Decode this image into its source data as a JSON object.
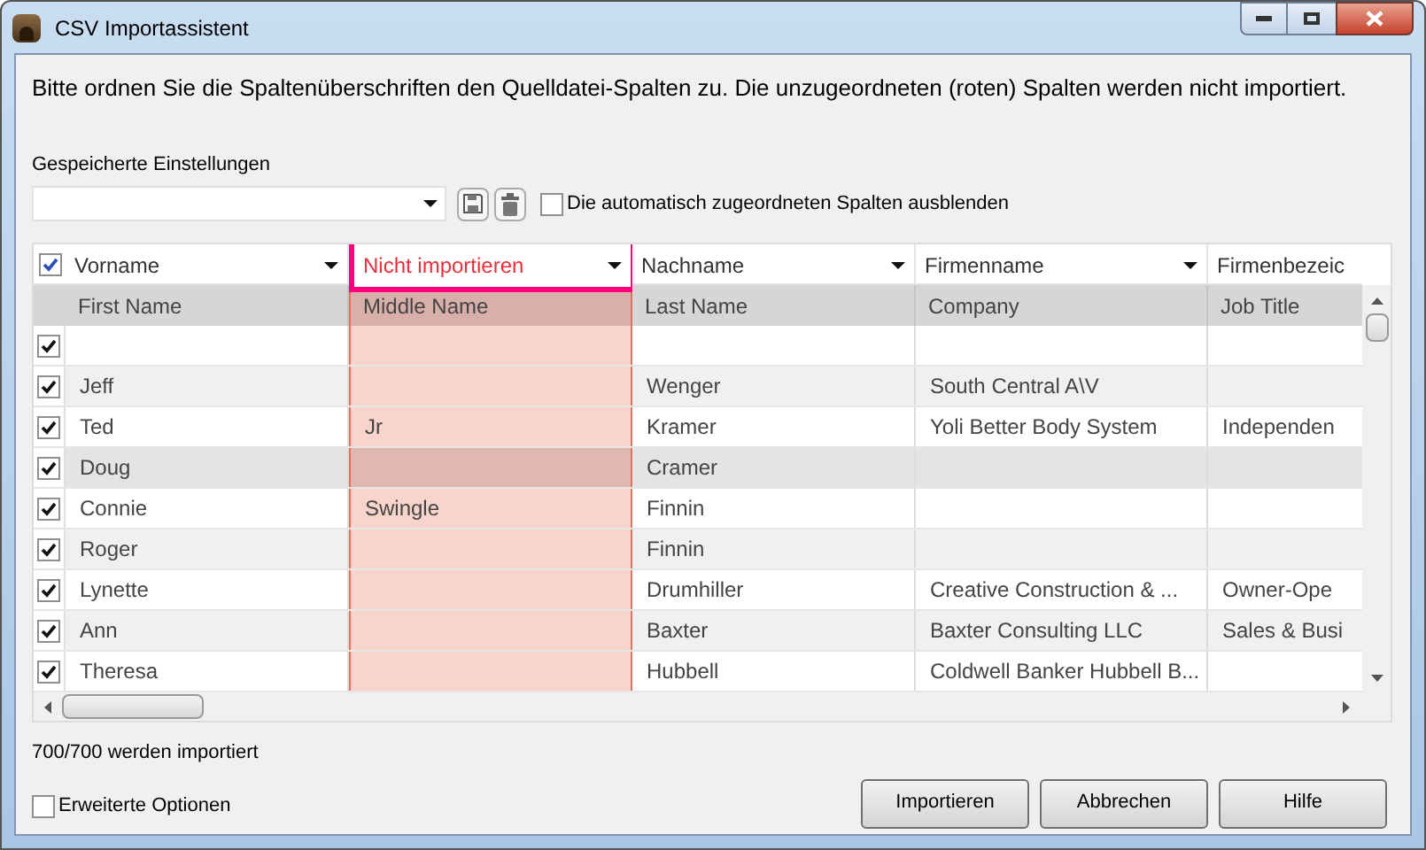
{
  "window": {
    "title": "CSV Importassistent"
  },
  "instructions": "Bitte ordnen Sie die Spaltenüberschriften den Quelldatei-Spalten zu. Die unzugeordneten (roten) Spalten werden nicht importiert.",
  "saved_settings": {
    "label": "Gespeicherte Einstellungen"
  },
  "hide_assigned": {
    "label": "Die automatisch zugeordneten Spalten ausblenden",
    "checked": false
  },
  "table": {
    "select_all_checked": true,
    "columns": [
      {
        "mapping": "Vorname",
        "source": "First Name",
        "ignored": false,
        "highlighted": false,
        "dropdown": true
      },
      {
        "mapping": "Nicht importieren",
        "source": "Middle Name",
        "ignored": true,
        "highlighted": true,
        "dropdown": true
      },
      {
        "mapping": "Nachname",
        "source": "Last Name",
        "ignored": false,
        "highlighted": false,
        "dropdown": true
      },
      {
        "mapping": "Firmenname",
        "source": "Company",
        "ignored": false,
        "highlighted": false,
        "dropdown": true
      },
      {
        "mapping": "Firmenbezeic",
        "source": "Job Title",
        "ignored": false,
        "highlighted": false,
        "dropdown": false
      }
    ],
    "rows": [
      {
        "checked": true,
        "selected": false,
        "cells": [
          null,
          null,
          null,
          null,
          null
        ]
      },
      {
        "checked": true,
        "selected": false,
        "cells": [
          "Jeff",
          null,
          "Wenger",
          "South Central A\\V",
          null
        ]
      },
      {
        "checked": true,
        "selected": false,
        "cells": [
          "Ted",
          "Jr",
          "Kramer",
          "Yoli Better Body System",
          "Independen"
        ]
      },
      {
        "checked": true,
        "selected": true,
        "cells": [
          "Doug",
          null,
          "Cramer",
          null,
          null
        ]
      },
      {
        "checked": true,
        "selected": false,
        "cells": [
          "Connie",
          "Swingle",
          "Finnin",
          null,
          null
        ]
      },
      {
        "checked": true,
        "selected": false,
        "cells": [
          "Roger",
          null,
          "Finnin",
          null,
          null
        ]
      },
      {
        "checked": true,
        "selected": false,
        "cells": [
          "Lynette",
          null,
          "Drumhiller",
          "Creative Construction & ...",
          "Owner-Ope"
        ]
      },
      {
        "checked": true,
        "selected": false,
        "cells": [
          "Ann",
          null,
          "Baxter",
          "Baxter Consulting LLC",
          "Sales & Busi"
        ]
      },
      {
        "checked": true,
        "selected": false,
        "cells": [
          "Theresa",
          null,
          "Hubbell",
          "Coldwell Banker Hubbell B...",
          null
        ]
      }
    ]
  },
  "status": "700/700 werden importiert",
  "advanced_options": {
    "label": "Erweiterte Optionen",
    "checked": false
  },
  "buttons": [
    "Importieren",
    "Abbrechen",
    "Hilfe"
  ]
}
